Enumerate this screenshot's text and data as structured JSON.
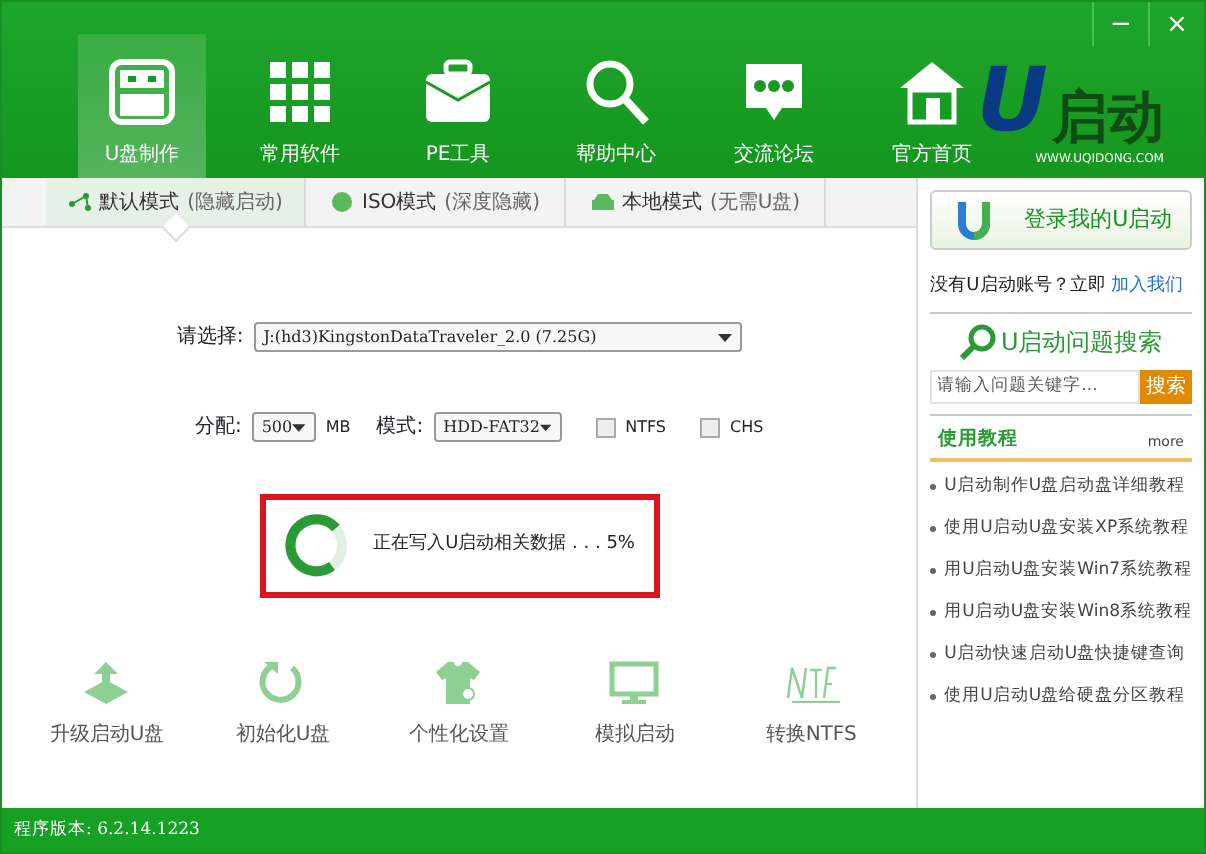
{
  "window": {
    "controls": [
      "−",
      "×"
    ]
  },
  "nav": [
    {
      "label": "U盘制作",
      "kind": "usb",
      "selected": true
    },
    {
      "label": "常用软件",
      "kind": "grid",
      "selected": false
    },
    {
      "label": "PE工具",
      "kind": "case",
      "selected": false
    },
    {
      "label": "帮助中心",
      "kind": "search",
      "selected": false
    },
    {
      "label": "交流论坛",
      "kind": "chat",
      "selected": false
    },
    {
      "label": "官方首页",
      "kind": "home",
      "selected": false
    }
  ],
  "logo": {
    "mark": "U",
    "text": "启动",
    "url": "WWW.UQIDONG.COM"
  },
  "tabs": [
    {
      "label": "默认模式",
      "note": "(隐藏启动)",
      "kind": "share",
      "selected": true
    },
    {
      "label": "ISO模式",
      "note": "(深度隐藏)",
      "kind": "disc",
      "selected": false
    },
    {
      "label": "本地模式",
      "note": "(无需U盘)",
      "kind": "drive",
      "selected": false
    }
  ],
  "form": {
    "device_label": "请选择:",
    "device": "J:(hd3)KingstonDataTraveler_2.0 (7.25G)",
    "alloc_label": "分配:",
    "alloc": "500",
    "alloc_unit": "MB",
    "mode_label": "模式:",
    "mode": "HDD-FAT32",
    "options": [
      {
        "label": "NTFS",
        "checked": false
      },
      {
        "label": "CHS",
        "checked": false
      }
    ]
  },
  "progress": {
    "message": "正在写入U启动相关数据 . . . 5%"
  },
  "tools": [
    {
      "label": "升级启动U盘",
      "kind": "upgrade"
    },
    {
      "label": "初始化U盘",
      "kind": "reset"
    },
    {
      "label": "个性化设置",
      "kind": "shirt"
    },
    {
      "label": "模拟启动",
      "kind": "monitor"
    },
    {
      "label": "转换NTFS",
      "kind": "ntfs"
    }
  ],
  "sidebar": {
    "login_button": "登录我的U启动",
    "no_account": "没有U启动账号？立即",
    "join_link": "加入我们",
    "search_title": "U启动问题搜索",
    "search_placeholder": "请输入问题关键字...",
    "search_button": "搜索",
    "tutorials_title": "使用教程",
    "more": "more",
    "tutorials": [
      "U启动制作U盘启动盘详细教程",
      "使用U启动U盘安装XP系统教程",
      "用U启动U盘安装Win7系统教程",
      "用U启动U盘安装Win8系统教程",
      "U启动快速启动U盘快捷键查询",
      "使用U启动U盘给硬盘分区教程"
    ]
  },
  "status_bar": {
    "version": "程序版本: 6.2.14.1223"
  }
}
